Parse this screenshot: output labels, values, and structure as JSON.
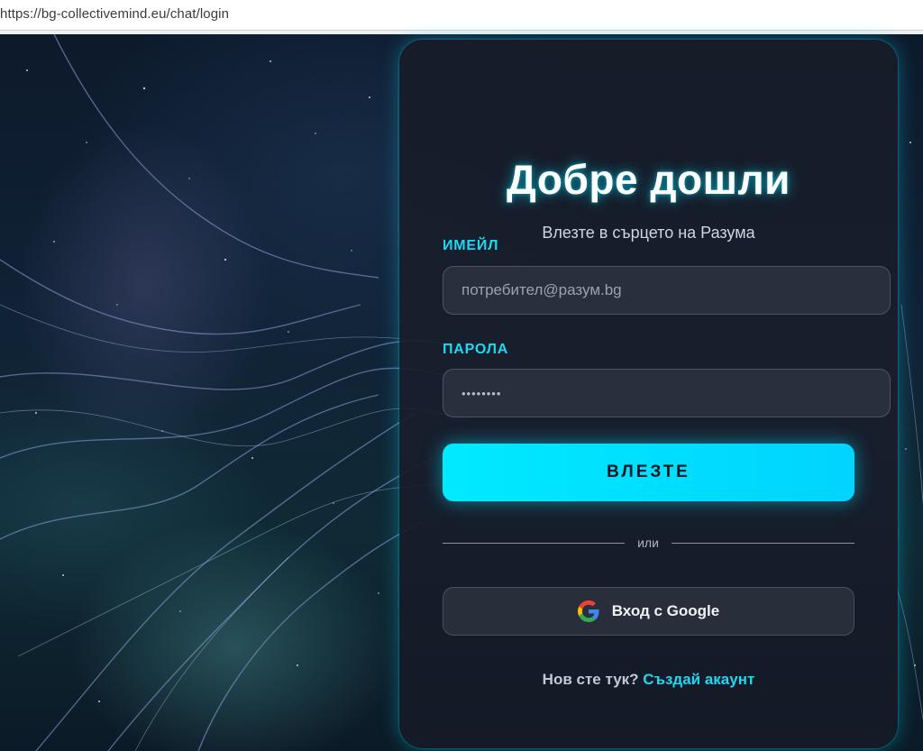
{
  "browser": {
    "url": "https://bg-collectivemind.eu/chat/login"
  },
  "login": {
    "title": "Добре дошли",
    "subtitle": "Влезте в сърцето на Разума",
    "email": {
      "label": "ИМЕЙЛ",
      "placeholder": "потребител@разум.bg",
      "value": ""
    },
    "password": {
      "label": "ПАРОЛА",
      "masked_value": "••••••••"
    },
    "submit_label": "ВЛЕЗТЕ",
    "divider_text": "или",
    "google_label": "Вход с Google",
    "signup_prompt": "Нов сте тук?",
    "signup_link": "Създай акаунт"
  },
  "colors": {
    "accent": "#00e5ff",
    "label": "#1ed8f2",
    "card_background": "#181e2c",
    "google_blue": "#4285F4",
    "google_red": "#EA4335",
    "google_yellow": "#FBBC05",
    "google_green": "#34A853"
  },
  "icons": {
    "google": "google-g-icon"
  }
}
